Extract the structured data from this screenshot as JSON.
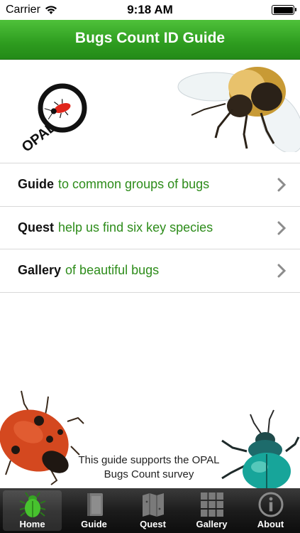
{
  "status_bar": {
    "carrier": "Carrier",
    "time": "9:18 AM"
  },
  "nav": {
    "title": "Bugs Count ID Guide"
  },
  "logo": {
    "text": "OPAL"
  },
  "menu": [
    {
      "bold": "Guide",
      "desc": "to common groups of bugs"
    },
    {
      "bold": "Quest",
      "desc": "help us find six key species"
    },
    {
      "bold": "Gallery",
      "desc": "of beautiful bugs"
    }
  ],
  "support_text": "This guide supports the OPAL Bugs Count survey",
  "tabs": [
    {
      "label": "Home",
      "icon": "bug-icon",
      "active": true
    },
    {
      "label": "Guide",
      "icon": "book-icon",
      "active": false
    },
    {
      "label": "Quest",
      "icon": "map-icon",
      "active": false
    },
    {
      "label": "Gallery",
      "icon": "grid-icon",
      "active": false
    },
    {
      "label": "About",
      "icon": "info-icon",
      "active": false
    }
  ],
  "colors": {
    "nav_green": "#2e9c1f",
    "desc_green": "#2d8c1a",
    "tab_bar": "#1c1c1c"
  }
}
